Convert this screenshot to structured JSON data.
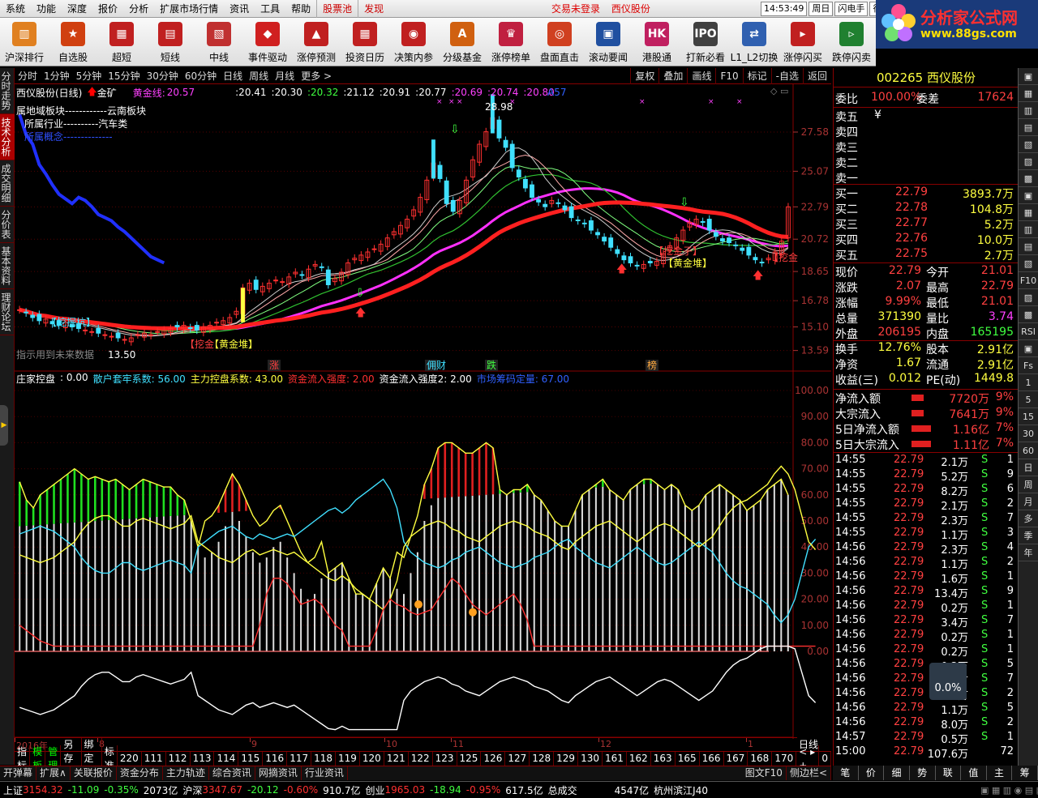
{
  "menu": {
    "items": [
      "系统",
      "功能",
      "深度",
      "报价",
      "分析",
      "扩展市场行情",
      "资讯",
      "工具",
      "帮助"
    ],
    "red_items": [
      "股票池",
      "发现"
    ],
    "status": [
      "交易未登录",
      "西仪股份"
    ],
    "time": "14:53:49",
    "weekday": "周日",
    "flash": "闪电手",
    "hang": "行"
  },
  "logo": {
    "title": "分析家公式网",
    "url": "www.88gs.com"
  },
  "toolbar": [
    {
      "label": "沪深排行",
      "color": "#e08020",
      "glyph": "▥"
    },
    {
      "label": "自选股",
      "color": "#d04010",
      "glyph": "★"
    },
    {
      "label": "超短",
      "color": "#c02020",
      "glyph": "▦"
    },
    {
      "label": "短线",
      "color": "#c02020",
      "glyph": "▤"
    },
    {
      "label": "中线",
      "color": "#c03030",
      "glyph": "▧"
    },
    {
      "label": "事件驱动",
      "color": "#d02020",
      "glyph": "◆"
    },
    {
      "label": "涨停预测",
      "color": "#c02020",
      "glyph": "▲"
    },
    {
      "label": "投资日历",
      "color": "#c02020",
      "glyph": "▦"
    },
    {
      "label": "决策内参",
      "color": "#c02020",
      "glyph": "◉"
    },
    {
      "label": "分级基金",
      "color": "#d06010",
      "glyph": "A"
    },
    {
      "label": "涨停榜单",
      "color": "#c02040",
      "glyph": "♛"
    },
    {
      "label": "盘面直击",
      "color": "#d04020",
      "glyph": "◎"
    },
    {
      "label": "滚动要闻",
      "color": "#2050a0",
      "glyph": "▣"
    },
    {
      "label": "港股通",
      "color": "#c02060",
      "glyph": "HK"
    },
    {
      "label": "打新必看",
      "color": "#404040",
      "glyph": "IPO"
    },
    {
      "label": "L1_L2切换",
      "color": "#3060b0",
      "glyph": "⇄"
    },
    {
      "label": "涨停闪买",
      "color": "#c02020",
      "glyph": "▸"
    },
    {
      "label": "跌停闪卖",
      "color": "#208030",
      "glyph": "▹"
    }
  ],
  "lefttabs": [
    "分时走势",
    "技术分析",
    "成交明细",
    "分价表",
    "基本资料",
    "理财论坛"
  ],
  "periods": [
    "分时",
    "1分钟",
    "5分钟",
    "15分钟",
    "30分钟",
    "60分钟",
    "日线",
    "周线",
    "月线",
    "更多 >"
  ],
  "period_right": [
    "复权",
    "叠加",
    "画线",
    "F10",
    "标记",
    "-自选",
    "返回"
  ],
  "chart_header": {
    "stock": "西仪股份(日线)",
    "name": "金矿",
    "golden_label": "黄金线:",
    "golden_value": "20.57",
    "values": [
      ":20.41",
      ":20.30",
      ":20.32",
      ":21.12",
      ":20.91",
      ":20.77",
      ":20.69",
      ":20.74",
      ":20.80"
    ],
    "value_colors": [
      "#ffffff",
      "#ffffff",
      "#40ff40",
      "#ffffff",
      "#ffffff",
      "#ffffff",
      "#ff40ff",
      "#ff40ff",
      "#ff40ff"
    ],
    "a57": "A57"
  },
  "sector": {
    "l1": "属地域板块------------云南板块",
    "l2": "所属行业----------汽车类",
    "l3": "所属概念--------------"
  },
  "price_axis": [
    "27.58",
    "25.07",
    "22.79",
    "20.72",
    "18.65",
    "16.78",
    "15.10",
    "13.59"
  ],
  "price_annotations": {
    "high": "28.98",
    "low": "13.50",
    "future": "指示用到未来数据",
    "wazhi": "【挖掘坑】",
    "wajin": "【挖金",
    "huangjin1": "【黄金堆】",
    "huangjin2": "【黄金堆】",
    "wajinzi": "【挖金子】",
    "wa3": "【挖金"
  },
  "event_markers": [
    "涨",
    "佣财",
    "跌",
    "榜"
  ],
  "indicator_header": [
    {
      "t": "庄家控盘",
      "c": "#fff"
    },
    {
      "t": ": 0.00",
      "c": "#fff"
    },
    {
      "t": "散户套牢系数: 56.00",
      "c": "#40e0ff"
    },
    {
      "t": "主力控盘系数: 43.00",
      "c": "#ffff40"
    },
    {
      "t": "资金流入强度: 2.00",
      "c": "#ff3030"
    },
    {
      "t": "资金流入强度2: 2.00",
      "c": "#fff"
    },
    {
      "t": "市场筹码定量: 67.00",
      "c": "#3060ff"
    }
  ],
  "ind_axis": [
    "100.00",
    "90.00",
    "80.00",
    "70.00",
    "60.00",
    "50.00",
    "40.00",
    "30.00",
    "20.00",
    "10.00",
    "0.00"
  ],
  "time_axis": [
    "2016年",
    "8",
    "9",
    "10",
    "11",
    "12",
    "1"
  ],
  "day_label": "日线",
  "bar1": [
    "指标",
    "模板",
    "管理",
    "另存为",
    "绑定到",
    "标准",
    "220",
    "111",
    "112",
    "113",
    "114",
    "115",
    "116",
    "117",
    "118",
    "119",
    "120",
    "121",
    "122",
    "123",
    "125",
    "126",
    "127",
    "128",
    "129",
    "130",
    "161",
    "162",
    "163",
    "165",
    "166",
    "167",
    "168",
    "170",
    "< ▸ + -",
    "0"
  ],
  "bar2": [
    "开弹幕",
    "扩展∧",
    "关联报价",
    "资金分布",
    "主力轨迹",
    "综合资讯",
    "网摘资讯",
    "行业资讯",
    "图文F10",
    "侧边栏<"
  ],
  "status": {
    "sh_name": "上证",
    "sh_val": "3154.32",
    "sh_chg": "-11.09",
    "sh_pct": "-0.35%",
    "sh_amt": "2073亿",
    "sz_name": "沪深",
    "sz_val": "3347.67",
    "sz_chg": "-20.12",
    "sz_pct": "-0.60%",
    "sz_amt": "910.7亿",
    "cy_name": "创业",
    "cy_val": "1965.03",
    "cy_chg": "-18.94",
    "cy_pct": "-0.95%",
    "cy_amt": "617.5亿",
    "total": "总成交",
    "total_val": "4547亿",
    "loc": "杭州滨江J40"
  },
  "quote": {
    "code": "002265",
    "name": "西仪股份",
    "weibi_l": "委比",
    "weibi": "100.00%",
    "weicha_l": "委差",
    "weicha": "17624",
    "sells": [
      {
        "l": "卖五",
        "p": "¥",
        "v": ""
      },
      {
        "l": "卖四",
        "p": "",
        "v": ""
      },
      {
        "l": "卖三",
        "p": "",
        "v": ""
      },
      {
        "l": "卖二",
        "p": "",
        "v": ""
      },
      {
        "l": "卖一",
        "p": "",
        "v": ""
      }
    ],
    "buys": [
      {
        "l": "买一",
        "p": "22.79",
        "v": "3893.7万"
      },
      {
        "l": "买二",
        "p": "22.78",
        "v": "104.8万"
      },
      {
        "l": "买三",
        "p": "22.77",
        "v": "5.2万"
      },
      {
        "l": "买四",
        "p": "22.76",
        "v": "10.0万"
      },
      {
        "l": "买五",
        "p": "22.75",
        "v": "2.7万"
      }
    ],
    "stats": [
      {
        "l1": "现价",
        "v1": "22.79",
        "c1": "#ff4040",
        "l2": "今开",
        "v2": "21.01",
        "c2": "#ff4040"
      },
      {
        "l1": "涨跌",
        "v1": "2.07",
        "c1": "#ff4040",
        "l2": "最高",
        "v2": "22.79",
        "c2": "#ff4040"
      },
      {
        "l1": "涨幅",
        "v1": "9.99%",
        "c1": "#ff4040",
        "l2": "最低",
        "v2": "21.01",
        "c2": "#ff4040"
      },
      {
        "l1": "总量",
        "v1": "371390",
        "c1": "#ffff40",
        "l2": "量比",
        "v2": "3.74",
        "c2": "#ff40ff"
      },
      {
        "l1": "外盘",
        "v1": "206195",
        "c1": "#ff4040",
        "l2": "内盘",
        "v2": "165195",
        "c2": "#40ff40"
      },
      {
        "l1": "换手",
        "v1": "12.76%",
        "c1": "#ffff40",
        "l2": "股本",
        "v2": "2.91亿",
        "c2": "#ffff40"
      },
      {
        "l1": "净资",
        "v1": "1.67",
        "c1": "#ffff40",
        "l2": "流通",
        "v2": "2.91亿",
        "c2": "#ffff40"
      },
      {
        "l1": "收益(三)",
        "v1": "0.012",
        "c1": "#ffff40",
        "l2": "PE(动)",
        "v2": "1449.8",
        "c2": "#ffff40"
      }
    ],
    "flows": [
      {
        "l": "净流入额",
        "v": "7720万",
        "p": "9%",
        "w": 0.5
      },
      {
        "l": "大宗流入",
        "v": "7641万",
        "p": "9%",
        "w": 0.5
      },
      {
        "l": "5日净流入额",
        "v": "1.16亿",
        "p": "7%",
        "w": 0.8
      },
      {
        "l": "5日大宗流入",
        "v": "1.11亿",
        "p": "7%",
        "w": 0.8
      }
    ],
    "ticks": [
      [
        "14:55",
        "22.79",
        "2.1万",
        "S",
        "1"
      ],
      [
        "14:55",
        "22.79",
        "5.2万",
        "S",
        "9"
      ],
      [
        "14:55",
        "22.79",
        "8.2万",
        "S",
        "6"
      ],
      [
        "14:55",
        "22.79",
        "2.1万",
        "S",
        "2"
      ],
      [
        "14:55",
        "22.79",
        "2.3万",
        "S",
        "7"
      ],
      [
        "14:55",
        "22.79",
        "1.1万",
        "S",
        "3"
      ],
      [
        "14:56",
        "22.79",
        "2.3万",
        "S",
        "4"
      ],
      [
        "14:56",
        "22.79",
        "1.1万",
        "S",
        "2"
      ],
      [
        "14:56",
        "22.79",
        "1.6万",
        "S",
        "1"
      ],
      [
        "14:56",
        "22.79",
        "13.4万",
        "S",
        "9"
      ],
      [
        "14:56",
        "22.79",
        "0.2万",
        "S",
        "1"
      ],
      [
        "14:56",
        "22.79",
        "3.4万",
        "S",
        "7"
      ],
      [
        "14:56",
        "22.79",
        "0.2万",
        "S",
        "1"
      ],
      [
        "14:56",
        "22.79",
        "0.2万",
        "S",
        "1"
      ],
      [
        "14:56",
        "22.79",
        "0.2万",
        "S",
        "5"
      ],
      [
        "14:56",
        "22.79",
        "0.2万",
        "S",
        "7"
      ],
      [
        "14:56",
        "22.79",
        "0.2万",
        "S",
        "2"
      ],
      [
        "14:56",
        "22.79",
        "1.1万",
        "S",
        "5"
      ],
      [
        "14:56",
        "22.79",
        "8.0万",
        "S",
        "2"
      ],
      [
        "14:57",
        "22.79",
        "0.5万",
        "S",
        "1"
      ]
    ],
    "last_tick": [
      "15:00",
      "22.79",
      "107.6万",
      "",
      "72"
    ]
  },
  "rtabs": [
    "▣",
    "▦",
    "▥",
    "▤",
    "▧",
    "▨",
    "▩",
    "▣",
    "▦",
    "▥",
    "▤",
    "▧",
    "F10",
    "▨",
    "▩",
    "RSI",
    "▣",
    "Fs",
    "1",
    "5",
    "15",
    "30",
    "60",
    "日",
    "周",
    "月",
    "多",
    "季",
    "年"
  ],
  "rbottom": [
    "笔",
    "价",
    "细",
    "势",
    "联",
    "值",
    "主",
    "筹"
  ],
  "tooltip": "0.0%",
  "chart_data": [
    {
      "type": "candlestick",
      "title": "西仪股份(日线)",
      "y_axis": [
        13.59,
        15.1,
        16.78,
        18.65,
        20.72,
        22.79,
        25.07,
        27.58
      ],
      "ylim": [
        13.0,
        29.5
      ],
      "close": [
        16.2,
        16.0,
        15.7,
        15.5,
        15.6,
        15.3,
        15.2,
        15.4,
        15.1,
        15.0,
        14.9,
        14.8,
        14.7,
        14.6,
        14.5,
        14.4,
        14.3,
        14.4,
        14.6,
        14.7,
        14.6,
        14.8,
        14.9,
        15.0,
        15.1,
        15.2,
        15.0,
        14.9,
        15.1,
        15.2,
        15.4,
        15.5,
        15.7,
        16.1,
        17.6,
        17.9,
        17.5,
        17.7,
        17.9,
        18.1,
        18.0,
        18.3,
        18.6,
        18.4,
        18.8,
        19.1,
        18.9,
        17.8,
        18.2,
        18.6,
        19.2,
        19.5,
        19.7,
        19.9,
        20.1,
        20.4,
        20.8,
        21.2,
        21.6,
        22.0,
        22.6,
        23.4,
        24.5,
        25.6,
        24.6,
        23.0,
        22.5,
        23.2,
        24.5,
        25.8,
        26.8,
        27.6,
        28.5,
        27.2,
        26.6,
        25.3,
        24.7,
        24.0,
        23.4,
        23.1,
        22.8,
        23.2,
        23.0,
        22.6,
        22.1,
        21.9,
        21.7,
        21.3,
        21.0,
        20.6,
        20.2,
        19.8,
        19.4,
        19.2,
        19.0,
        19.1,
        19.2,
        19.3,
        19.8,
        20.3,
        20.8,
        21.3,
        21.8,
        22.0,
        21.8,
        21.3,
        20.9,
        20.6,
        20.5,
        20.3,
        20.0,
        19.7,
        19.4,
        19.2,
        19.5,
        19.9,
        20.6,
        22.79
      ]
    },
    {
      "type": "bar",
      "title": "庄家控盘",
      "y_axis": [
        0,
        10,
        20,
        30,
        40,
        50,
        60,
        70,
        80,
        90,
        100
      ],
      "ylim": [
        0,
        100
      ],
      "series": [
        {
          "name": "散户套牢系数",
          "values": [
            65,
            58,
            55,
            60,
            62,
            64,
            66,
            68,
            70,
            68,
            66,
            67,
            66,
            65,
            66,
            64,
            62,
            64,
            66,
            65,
            64,
            63,
            63,
            60,
            58,
            50,
            40,
            36,
            38,
            42,
            48,
            54,
            50,
            44,
            38,
            34,
            36,
            40,
            42,
            36,
            30,
            24,
            20,
            22,
            28,
            30,
            32,
            34,
            28,
            22,
            22,
            20,
            26,
            32,
            28,
            24,
            22,
            30,
            38,
            50,
            56,
            64,
            66,
            66,
            64,
            62,
            62,
            64,
            66,
            64,
            62,
            60,
            62,
            62,
            64,
            60,
            58,
            54,
            50,
            48,
            48,
            54,
            60,
            62,
            64,
            66,
            62,
            60,
            58,
            62,
            64,
            66,
            66,
            64,
            62,
            64,
            62,
            56,
            54,
            56,
            60,
            62,
            64,
            62,
            60,
            58,
            54,
            56,
            58,
            62,
            64,
            66,
            60
          ]
        },
        {
          "name": "主力控盘系数",
          "values": [
            45,
            46,
            47,
            48,
            47,
            46,
            44,
            42,
            40,
            36,
            33,
            31,
            30,
            30,
            32,
            34,
            34,
            32,
            31,
            32,
            33,
            34,
            35,
            34,
            33,
            30,
            40,
            42,
            44,
            46,
            47,
            48,
            46,
            44,
            43,
            45,
            44,
            43,
            44,
            45,
            44,
            46,
            48,
            50,
            52,
            54,
            55,
            53,
            55,
            58,
            60,
            62,
            64,
            66,
            62,
            55,
            42,
            38,
            36,
            34,
            33,
            32,
            33,
            35,
            36,
            38,
            39,
            40,
            38,
            36,
            34,
            33,
            32,
            33,
            34,
            36,
            37,
            38,
            40,
            42,
            43,
            40,
            38,
            36,
            34,
            33,
            32,
            34,
            36,
            38,
            40,
            38,
            36,
            34,
            33,
            34,
            36,
            38,
            40,
            42,
            40,
            38,
            34,
            30,
            27,
            25,
            24,
            22,
            20,
            18,
            14,
            11,
            14,
            20,
            30,
            40,
            43
          ]
        },
        {
          "name": "资金流入强度",
          "values": [
            10,
            8,
            6,
            4,
            3,
            2,
            2,
            2,
            2,
            2,
            2,
            2,
            2,
            2,
            2,
            2,
            2,
            2,
            2,
            2,
            2,
            2,
            2,
            2,
            2,
            2,
            2,
            2,
            2,
            2,
            2,
            2,
            2,
            2,
            2,
            10,
            22,
            28,
            28,
            26,
            22,
            18,
            19,
            20,
            18,
            14,
            10,
            8,
            2,
            2,
            2,
            2,
            8,
            16,
            20,
            18,
            17,
            15,
            14,
            15,
            16,
            20,
            24,
            28,
            26,
            22,
            18,
            16,
            14,
            16,
            18,
            20,
            22,
            18,
            12,
            2,
            2,
            2,
            2,
            2,
            2,
            2,
            2,
            2,
            2,
            2,
            2,
            2,
            2,
            2,
            2,
            2,
            2,
            2,
            2,
            2,
            2,
            2,
            2,
            2,
            2,
            2,
            2,
            2,
            2,
            2,
            2,
            2,
            2,
            2,
            2,
            2,
            2,
            2,
            2,
            2,
            2
          ]
        }
      ]
    }
  ]
}
